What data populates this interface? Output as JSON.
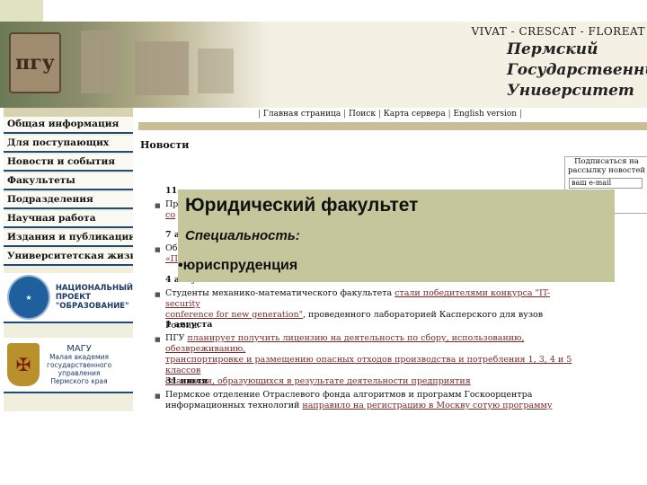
{
  "site": {
    "motto": "VIVAT - CRESCAT - FLOREAT",
    "university_lines": [
      "Пермский",
      "Государственный",
      "Университет"
    ],
    "logo_text": "пгу"
  },
  "top_links": [
    "Главная страница",
    "Поиск",
    "Карта сервера",
    "English version"
  ],
  "sidebar": {
    "items": [
      "Общая информация",
      "Для поступающих",
      "Новости и события",
      "Факультеты",
      "Подразделения",
      "Научная работа",
      "Издания и публикации",
      "Университетская жизнь"
    ],
    "banner1_lines": [
      "НАЦИОНАЛЬНЫЙ",
      "ПРОЕКТ",
      "\"ОБРАЗОВАНИЕ\""
    ],
    "banner2_title": "МАГУ",
    "banner2_lines": [
      "Малая академия",
      "государственного",
      "управления",
      "Пермского края"
    ]
  },
  "news_heading": "Новости",
  "subscribe": {
    "label_lines": [
      "Подписаться на",
      "рассылку новостей"
    ],
    "input_value": "ваш e-mail"
  },
  "news": [
    {
      "date": "11",
      "line1": "Пр",
      "line2_link": "со"
    },
    {
      "date": "7 а",
      "line1": "Об",
      "line2_link": "«П"
    },
    {
      "date": "4 августа",
      "text_a": "Студенты механико-математического факультета ",
      "link_a": "стали победителями конкурса \"IT-security",
      "link_b": "conference for new generation\"",
      "text_b": ", проведенного лабораторией Касперского для вузов России."
    },
    {
      "date": "1 августа",
      "text_a": "ПГУ ",
      "link_a": "планирует получить лицензию на деятельность по сбору, использованию, обезвреживанию,",
      "link_b": "транспортировке и размещению опасных отходов производства и потребления 1, 3, 4 и 5 классов",
      "link_c": "опасности, образующихся в результате деятельности предприятия"
    },
    {
      "date": "31 июля",
      "text_a": "Пермское отделение Отраслевого фонда алгоритмов и программ Госкоорцентра",
      "text_b": "информационных технологий ",
      "link_a": "направило на регистрацию в Москву сотую программу"
    }
  ],
  "overlay": {
    "title": "Юридический факультет",
    "specialty_label": "Специальность:",
    "specialty_item": "•юриспруденция"
  }
}
